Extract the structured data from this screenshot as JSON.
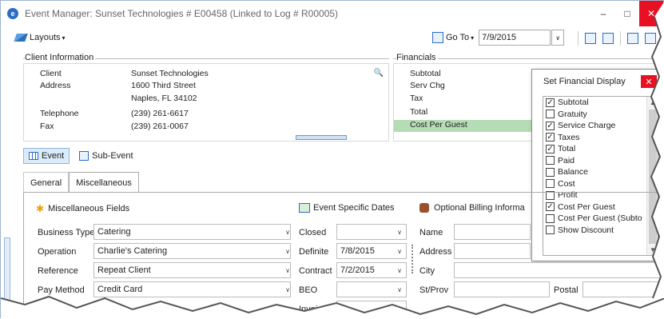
{
  "window": {
    "title": "Event Manager:  Sunset Technologies # E00458  (Linked to Log # R00005)",
    "app_icon_glyph": "e",
    "minimize_glyph": "–",
    "maximize_glyph": "□",
    "close_glyph": "✕"
  },
  "toolbar": {
    "layouts_label": "Layouts",
    "goto_label": "Go To",
    "goto_date": "7/9/2015"
  },
  "client_info": {
    "header": "Client Information",
    "rows": [
      {
        "label": "Client",
        "value": "Sunset Technologies"
      },
      {
        "label": "Address",
        "value": "1600 Third Street"
      },
      {
        "label": "",
        "value": "Naples, FL 34102"
      },
      {
        "label": "Telephone",
        "value": "(239) 261-6617"
      },
      {
        "label": "Fax",
        "value": "(239) 261-0067"
      }
    ]
  },
  "financials": {
    "header": "Financials",
    "rows": [
      "Subtotal",
      "Serv Chg",
      "Tax",
      "Total",
      "Cost Per Guest"
    ],
    "selected_row": "Cost Per Guest"
  },
  "financial_display": {
    "title": "Set Financial Display",
    "items": [
      {
        "label": "Subtotal",
        "checked": true
      },
      {
        "label": "Gratuity",
        "checked": false
      },
      {
        "label": "Service Charge",
        "checked": true
      },
      {
        "label": "Taxes",
        "checked": true
      },
      {
        "label": "Total",
        "checked": true
      },
      {
        "label": "Paid",
        "checked": false
      },
      {
        "label": "Balance",
        "checked": false
      },
      {
        "label": "Cost",
        "checked": false
      },
      {
        "label": "Profit",
        "checked": false
      },
      {
        "label": "Cost Per Guest",
        "checked": true
      },
      {
        "label": "Cost Per Guest (Subto",
        "checked": false
      },
      {
        "label": "Show Discount",
        "checked": false
      }
    ],
    "check_glyph": "✓"
  },
  "event_toggle": {
    "event_label": "Event",
    "sub_event_label": "Sub-Event"
  },
  "tabs": [
    "General",
    "Miscellaneous"
  ],
  "misc": {
    "header": "Miscellaneous Fields",
    "fields": [
      {
        "label": "Business Type",
        "value": "Catering"
      },
      {
        "label": "Operation",
        "value": "Charlie's Catering"
      },
      {
        "label": "Reference",
        "value": "Repeat Client"
      },
      {
        "label": "Pay Method",
        "value": "Credit Card"
      }
    ]
  },
  "event_dates": {
    "header": "Event Specific Dates",
    "fields": [
      {
        "label": "Closed",
        "value": ""
      },
      {
        "label": "Definite",
        "value": "7/8/2015"
      },
      {
        "label": "Contract",
        "value": "7/2/2015"
      },
      {
        "label": "BEO",
        "value": ""
      },
      {
        "label": "Invoice",
        "value": ""
      }
    ]
  },
  "billing": {
    "header": "Optional Billing Informa",
    "fields": [
      "Name",
      "Address",
      "City",
      "St/Prov"
    ],
    "postal_label": "Postal"
  },
  "glyphs": {
    "caret": "▾",
    "dropdown": "∨",
    "search": "🔍",
    "star": "✱"
  }
}
